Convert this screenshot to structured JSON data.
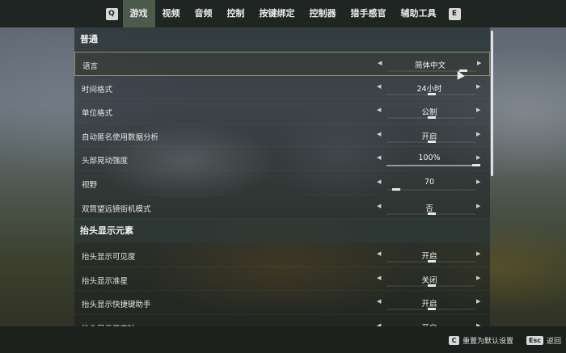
{
  "topbar": {
    "left_key": "Q",
    "right_key": "E",
    "tabs": [
      {
        "label": "游戏",
        "active": true
      },
      {
        "label": "视频",
        "active": false
      },
      {
        "label": "音频",
        "active": false
      },
      {
        "label": "控制",
        "active": false
      },
      {
        "label": "按键绑定",
        "active": false
      },
      {
        "label": "控制器",
        "active": false
      },
      {
        "label": "猎手感官",
        "active": false
      },
      {
        "label": "辅助工具",
        "active": false
      }
    ]
  },
  "sections": [
    {
      "title": "普通",
      "rows": [
        {
          "label": "语言",
          "value": "简体中文",
          "selected": true,
          "level": 0.85
        },
        {
          "label": "时间格式",
          "value": "24小时",
          "level": 0.5
        },
        {
          "label": "单位格式",
          "value": "公制",
          "level": 0.5
        },
        {
          "label": "自动匿名使用数据分析",
          "value": "开启",
          "level": 0.5
        },
        {
          "label": "头部晃动强度",
          "value": "100%",
          "level": 1.0,
          "full": true
        },
        {
          "label": "视野",
          "value": "70",
          "level": 0.1
        },
        {
          "label": "双筒望远镜街机模式",
          "value": "否",
          "level": 0.5
        }
      ]
    },
    {
      "title": "抬头显示元素",
      "rows": [
        {
          "label": "抬头显示可见度",
          "value": "开启",
          "level": 0.5
        },
        {
          "label": "抬头显示准星",
          "value": "关闭",
          "level": 0.5
        },
        {
          "label": "抬头显示快捷键助手",
          "value": "开启",
          "level": 0.5
        },
        {
          "label": "抬头显示指南针",
          "value": "开启",
          "level": 0.5
        }
      ]
    }
  ],
  "bottombar": {
    "reset": {
      "key": "C",
      "label": "重置为默认设置"
    },
    "back": {
      "key": "Esc",
      "label": "返回"
    }
  }
}
